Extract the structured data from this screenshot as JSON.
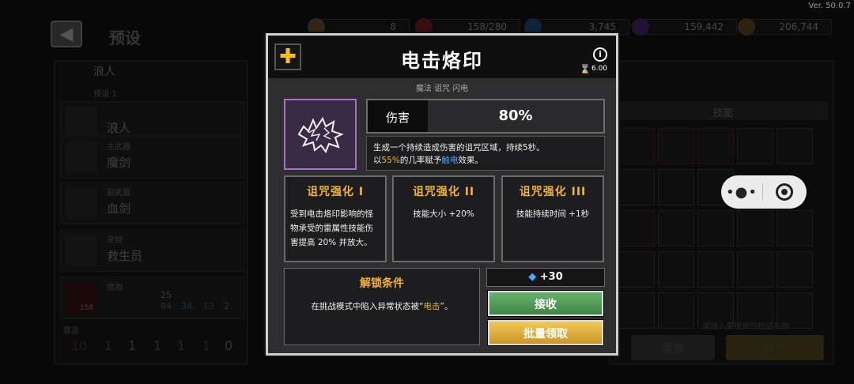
{
  "app": {
    "version": "Ver. 50.0.7"
  },
  "background": {
    "title": "预设",
    "resources": [
      {
        "name": "scroll",
        "value": "8",
        "icon": "scroll-icon",
        "color": "#b08a5a"
      },
      {
        "name": "stamina",
        "value": "158/280",
        "icon": "no-entry-icon",
        "color": "#c92b2b"
      },
      {
        "name": "gems",
        "value": "3,745",
        "icon": "gem-icon",
        "color": "#3c8ce6"
      },
      {
        "name": "purple-crystal",
        "value": "159,442",
        "icon": "crystal-icon",
        "color": "#8a3cc8"
      },
      {
        "name": "gold",
        "value": "206,744",
        "icon": "coin-icon",
        "color": "#b07a3a"
      }
    ],
    "left_panel": {
      "character": "浪人",
      "preset": "预设 1",
      "items": [
        {
          "sub": "",
          "main": "浪人"
        },
        {
          "sub": "主武器",
          "main": "魔剑"
        },
        {
          "sub": "副武器",
          "main": "血剑"
        },
        {
          "sub": "宠物",
          "main": "救生员"
        },
        {
          "sub": "禁用",
          "main": ""
        }
      ],
      "stats": {
        "count": "25",
        "a": "84",
        "b": "34",
        "c": "13",
        "d": "2",
        "left": "158"
      },
      "tier_label": "罪恶",
      "tier_values": [
        "10",
        "1",
        "1",
        "1",
        "1",
        "1",
        "0"
      ]
    },
    "right_panel": {
      "header": "技能",
      "search_placeholder": "请输入要搜索的物品名称",
      "reset_label": "重置",
      "save_label": "保存"
    }
  },
  "modal": {
    "title": "电击烙印",
    "cooldown": "6.00",
    "tags": "魔法  诅咒  闪电",
    "damage_label": "伤害",
    "damage_value": "80%",
    "desc_line1": "生成一个持续造成伤害的诅咒区域，持续5秒。",
    "desc_line2_prefix": "以",
    "desc_line2_pct": "55%",
    "desc_line2_mid": "的几率赋予",
    "desc_line2_effect": "触电",
    "desc_line2_suffix": "效果。",
    "enhancements": [
      {
        "title": "诅咒强化 I",
        "desc": "受到电击烙印影响的怪物承受的雷属性技能伤害提高 20% 并放大。"
      },
      {
        "title": "诅咒强化 II",
        "desc": "技能大小 +20%"
      },
      {
        "title": "诅咒强化 III",
        "desc": "技能持续时间 +1秒"
      }
    ],
    "unlock": {
      "title": "解锁条件",
      "desc_prefix": "在挑战模式中陷入异常状态被“",
      "desc_highlight": "电击",
      "desc_suffix": "”。"
    },
    "reward": "+30",
    "accept_label": "接收",
    "batch_label": "批量领取",
    "colors": {
      "accent": "#f2b33a",
      "highlight_blue": "#4aa3ff",
      "accept": "#4f9a55",
      "batch": "#e0ae3c",
      "icon_border": "#a673c0"
    }
  }
}
